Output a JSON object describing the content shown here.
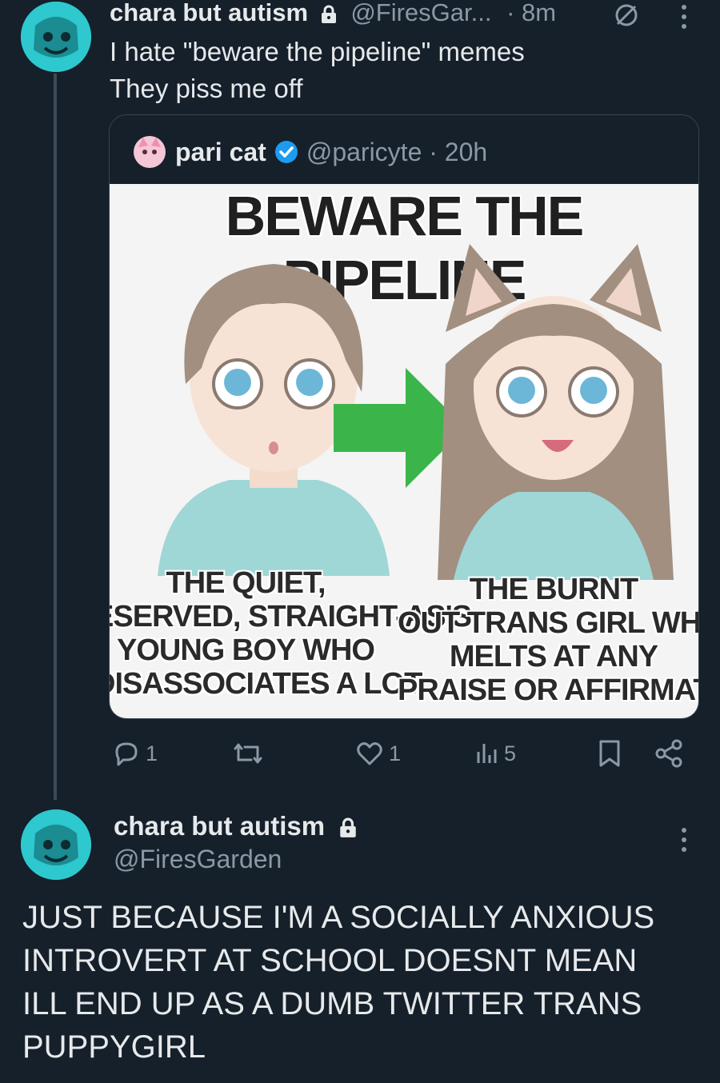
{
  "tweet1": {
    "display_name": "chara but autism",
    "handle": "@FiresGar...",
    "time": "· 8m",
    "text_line1": "I hate \"beware the pipeline\" memes",
    "text_line2": "They piss me off"
  },
  "quote": {
    "display_name": "pari cat",
    "handle_time": "@paricyte · 20h",
    "meme_title": "BEWARE THE PIPELINE",
    "left_caption": "THE QUIET,\nESERVED, STRAIGHT-AS'S\nYOUNG BOY WHO\nDISASSOCIATES A LOT",
    "right_caption": "THE BURNT\nOUT TRANS GIRL WHO\nMELTS AT ANY\nPRAISE OR AFFIRMATIO"
  },
  "actions": {
    "replies": "1",
    "likes": "1",
    "views": "5"
  },
  "tweet2": {
    "display_name": "chara but autism",
    "handle": "@FiresGarden",
    "text": "JUST BECAUSE I'M A SOCIALLY ANXIOUS INTROVERT AT SCHOOL DOESNT MEAN ILL END UP AS A DUMB TWITTER TRANS PUPPYGIRL"
  },
  "colors": {
    "background": "#15202b",
    "text": "#e7e9ea",
    "muted": "#8b98a5",
    "verified": "#1d9bf0",
    "avatar": "#2ec8cf",
    "arrow": "#3bb54a"
  }
}
